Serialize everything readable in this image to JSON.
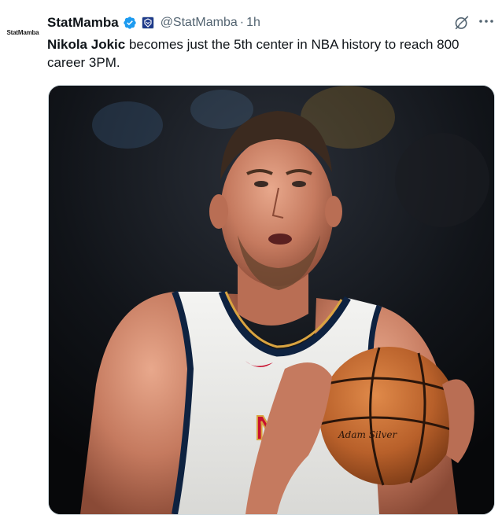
{
  "author": {
    "name": "StatMamba",
    "handle": "@StatMamba",
    "time": "1h",
    "separator": "·",
    "avatar_text": "StatMamba"
  },
  "tweet": {
    "mention": "Nikola Jokic",
    "text": " becomes just the 5th center in NBA history to reach 800 career 3PM."
  },
  "media": {
    "jersey_lettering": "NU",
    "ball_brand": "Adam Silver"
  },
  "icons": {
    "verified": "verified-badge-icon",
    "affiliate": "affiliate-badge-icon",
    "grok": "grok-icon",
    "more": "more-icon"
  },
  "colors": {
    "verified_blue": "#1d9bf0",
    "text": "#0f1419",
    "secondary_text": "#536471",
    "jersey_navy": "#0e2240",
    "jersey_gold": "#d9a441",
    "jersey_red": "#c8102e",
    "ball_orange": "#c86a2e"
  }
}
